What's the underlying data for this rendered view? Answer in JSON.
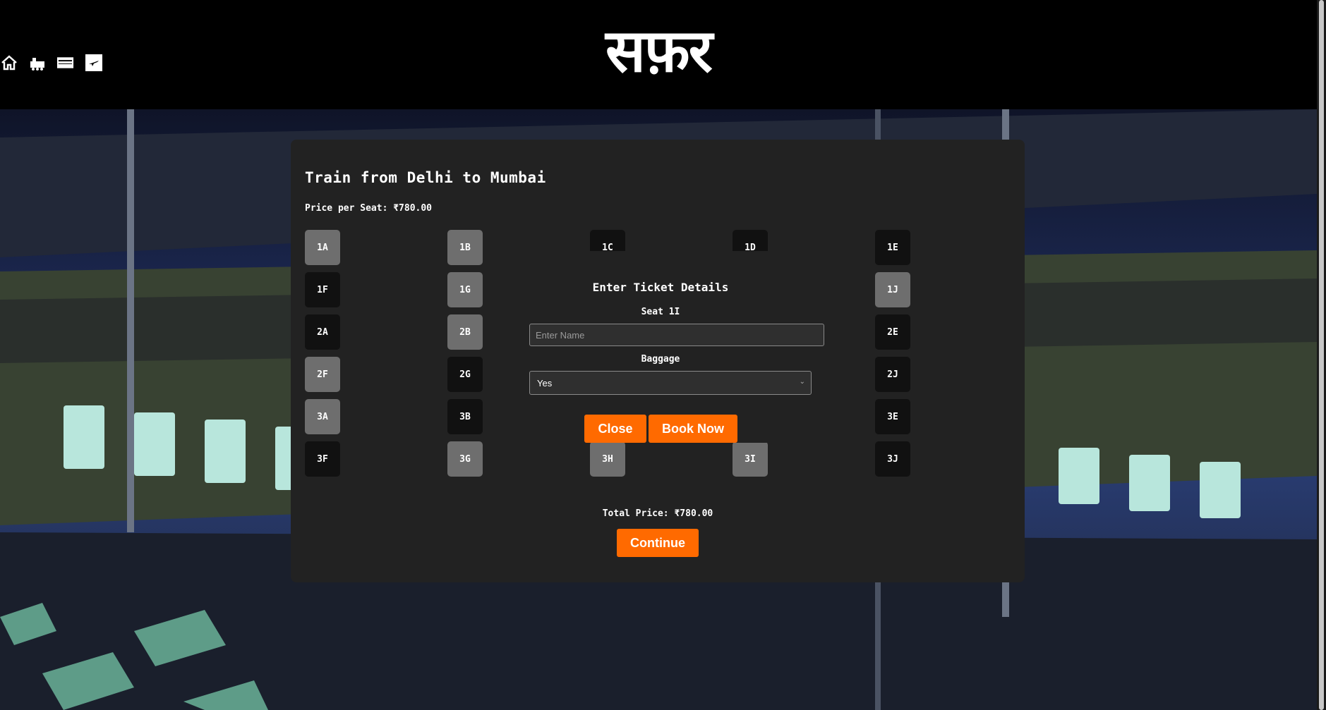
{
  "header": {
    "brand": "सफ़र",
    "nav": [
      {
        "name": "home-icon"
      },
      {
        "name": "train-icon"
      },
      {
        "name": "bus-icon"
      },
      {
        "name": "plane-icon"
      }
    ]
  },
  "booking": {
    "title": "Train from Delhi to Mumbai",
    "price_per_seat": "Price per Seat: ₹780.00",
    "total_price": "Total Price: ₹780.00",
    "continue_label": "Continue",
    "seats": [
      {
        "label": "1A",
        "status": "taken"
      },
      {
        "label": "1B",
        "status": "taken"
      },
      {
        "label": "1C",
        "status": "free"
      },
      {
        "label": "1D",
        "status": "free"
      },
      {
        "label": "1E",
        "status": "free"
      },
      {
        "label": "1F",
        "status": "free"
      },
      {
        "label": "1G",
        "status": "taken"
      },
      {
        "label": "1J",
        "status": "taken"
      },
      {
        "label": "2A",
        "status": "free"
      },
      {
        "label": "2B",
        "status": "taken"
      },
      {
        "label": "2E",
        "status": "free"
      },
      {
        "label": "2F",
        "status": "taken"
      },
      {
        "label": "2G",
        "status": "free"
      },
      {
        "label": "2J",
        "status": "free"
      },
      {
        "label": "3A",
        "status": "taken"
      },
      {
        "label": "3B",
        "status": "free"
      },
      {
        "label": "3E",
        "status": "free"
      },
      {
        "label": "3F",
        "status": "free"
      },
      {
        "label": "3G",
        "status": "taken"
      },
      {
        "label": "3H",
        "status": "taken"
      },
      {
        "label": "3I",
        "status": "taken"
      },
      {
        "label": "3J",
        "status": "free"
      }
    ]
  },
  "modal": {
    "title": "Enter Ticket Details",
    "seat_label": "Seat 1I",
    "name_placeholder": "Enter Name",
    "baggage_label": "Baggage",
    "baggage_value": "Yes",
    "close_label": "Close",
    "book_label": "Book Now"
  },
  "colors": {
    "accent": "#ff6a00",
    "card_bg": "#222222",
    "seat_free": "#111111",
    "seat_taken": "#6e6e6e"
  }
}
